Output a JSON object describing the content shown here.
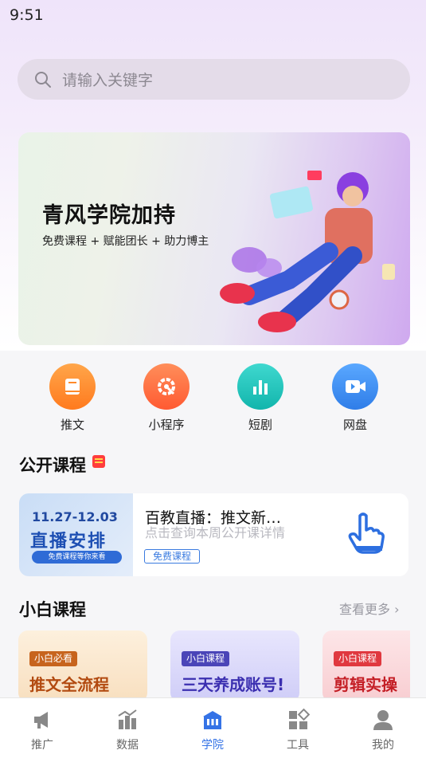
{
  "status_bar": {
    "time": "9:51"
  },
  "search": {
    "placeholder": "请输入关键字"
  },
  "banner": {
    "title": "青风学院加持",
    "subtitle": "免费课程 + 赋能团长 + 助力博主"
  },
  "quick_links": [
    {
      "label": "推文",
      "icon": "book-icon",
      "color": "#ff8a2a"
    },
    {
      "label": "小程序",
      "icon": "gear-tool-icon",
      "color": "#ff6a3d"
    },
    {
      "label": "短剧",
      "icon": "bar-chart-icon",
      "color": "#1cc5bd"
    },
    {
      "label": "网盘",
      "icon": "video-camera-icon",
      "color": "#3a8ef0"
    }
  ],
  "public_courses": {
    "title": "公开课程",
    "card": {
      "thumb_date": "11.27-12.03",
      "thumb_title": "直播安排",
      "thumb_pill": "免费课程等你来看",
      "title": "百教直播：推文新…",
      "subtitle": "点击查询本周公开课详情",
      "tag": "免费课程"
    }
  },
  "beginner_courses": {
    "title": "小白课程",
    "more": "查看更多",
    "items": [
      {
        "tag": "小白必看",
        "name": "推文全流程",
        "bg": "#fbe6cc",
        "tag_color": "#c7641d",
        "name_color": "#b24a10"
      },
      {
        "tag": "小白课程",
        "name": "三天养成账号!",
        "bg": "#dcdcfb",
        "tag_color": "#4a45b8",
        "name_color": "#3b2fb0"
      },
      {
        "tag": "小白课程",
        "name": "剪辑实操",
        "bg": "#fbd9dc",
        "tag_color": "#e0383f",
        "name_color": "#c41e25"
      }
    ]
  },
  "tabbar": [
    {
      "label": "推广",
      "icon": "megaphone-icon"
    },
    {
      "label": "数据",
      "icon": "chart-icon"
    },
    {
      "label": "学院",
      "icon": "academy-icon"
    },
    {
      "label": "工具",
      "icon": "tools-grid-icon"
    },
    {
      "label": "我的",
      "icon": "user-icon"
    }
  ],
  "active_tab": "学院",
  "colors": {
    "accent": "#3573e6",
    "search_bg": "#e4dce9"
  }
}
